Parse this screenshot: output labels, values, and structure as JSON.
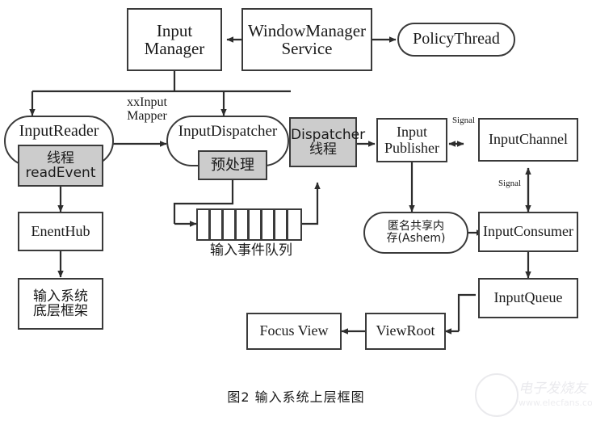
{
  "figure": {
    "caption": "图2  输入系统上层框图",
    "type": "block-diagram",
    "background": "#ffffff",
    "line_color": "#3a3a3a",
    "shade_color": "#cccccc"
  },
  "nodes": {
    "input_manager": {
      "label": "Input\nManager",
      "shape": "rect",
      "fill": "white"
    },
    "wms": {
      "label": "WindowManager\nService",
      "shape": "rect",
      "fill": "white"
    },
    "policy_thread": {
      "label": "PolicyThread",
      "shape": "oval",
      "fill": "white"
    },
    "input_reader": {
      "label": "InputReader",
      "shape": "oval",
      "fill": "white"
    },
    "reader_thread": {
      "label": "线程\nreadEvent",
      "shape": "rect",
      "fill": "shaded"
    },
    "input_dispatcher": {
      "label": "InputDispatcher",
      "shape": "oval",
      "fill": "white"
    },
    "preprocess": {
      "label": "预处理",
      "shape": "rect",
      "fill": "shaded"
    },
    "dispatcher_thread": {
      "label": "Dispatcher\n线程",
      "shape": "rect",
      "fill": "shaded"
    },
    "input_publisher": {
      "label": "Input\nPublisher",
      "shape": "rect",
      "fill": "white"
    },
    "input_channel": {
      "label": "InputChannel",
      "shape": "rect",
      "fill": "white"
    },
    "ashem": {
      "label": "匿名共享内\n存(Ashem)",
      "shape": "oval",
      "fill": "white"
    },
    "input_consumer": {
      "label": "InputConsumer",
      "shape": "rect",
      "fill": "white"
    },
    "input_queue": {
      "label": "InputQueue",
      "shape": "rect",
      "fill": "white"
    },
    "view_root": {
      "label": "ViewRoot",
      "shape": "rect",
      "fill": "white"
    },
    "focus_view": {
      "label": "Focus View",
      "shape": "rect",
      "fill": "white"
    },
    "enent_hub": {
      "label": "EnentHub",
      "shape": "rect",
      "fill": "white"
    },
    "input_framework": {
      "label": "输入系统\n底层框架",
      "shape": "rect",
      "fill": "white"
    },
    "event_queue": {
      "label": "输入事件队列",
      "shape": "queue",
      "cells": 8,
      "fill": "white"
    }
  },
  "edge_labels": {
    "xx_input_mapper": "xxInput\nMapper",
    "signal_horizontal": "Signal",
    "signal_vertical": "Signal",
    "queue_caption": "输入事件队列"
  },
  "watermark": {
    "name": "电子发烧友",
    "url": "www.elecfans.com"
  }
}
